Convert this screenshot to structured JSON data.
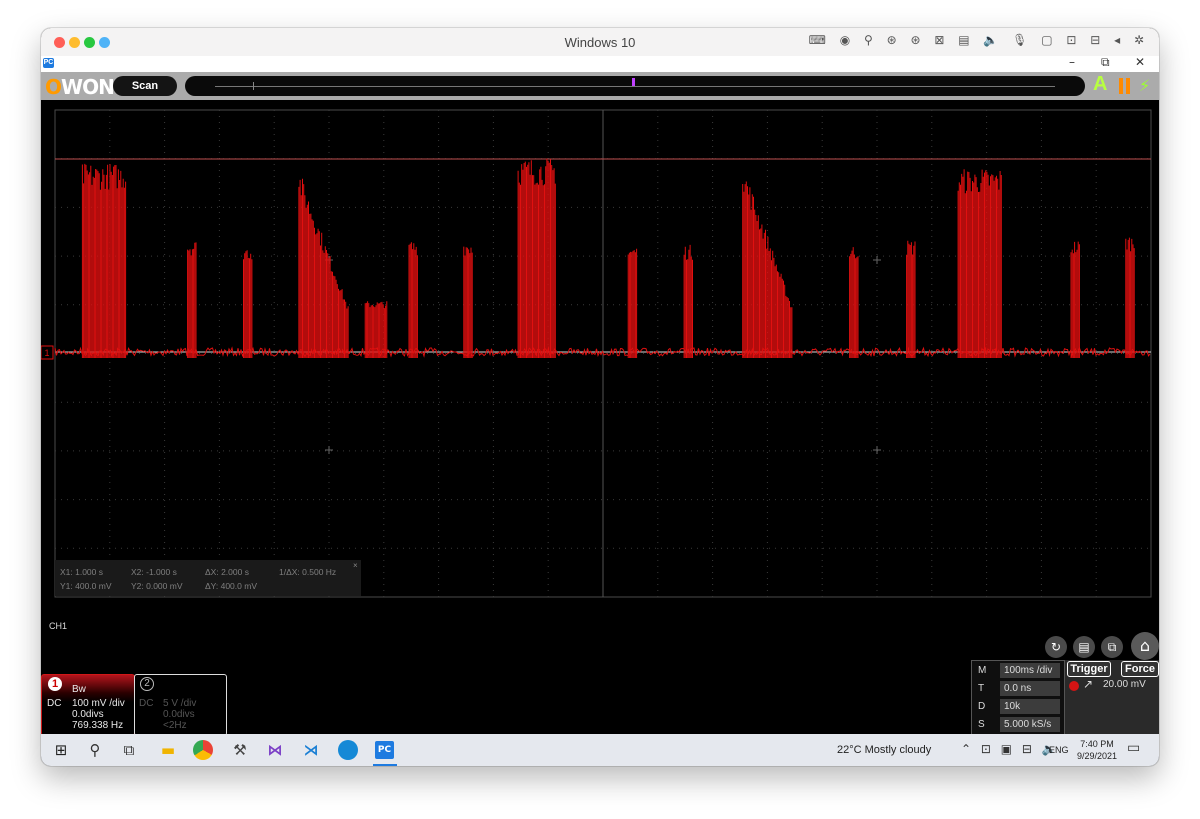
{
  "mac_window": {
    "title": "Windows 10",
    "traffic_lights": [
      "#ff5f57",
      "#febc2e",
      "#28c840",
      "#4fb3f7"
    ],
    "menu_icons": "⌨ ◉ ⚲ ⊛ ⊛ ⊠ ▤ 🔈 🎙 ▢ ⊡ ⊟ ◂ ✲"
  },
  "app_window": {
    "icon_label": "PC",
    "minimize": "–",
    "restore": "⧉",
    "close": "✕"
  },
  "toolbar": {
    "logo_o": "O",
    "logo_rest": "WON",
    "scan_label": "Scan",
    "run_label": "A"
  },
  "cursor_readout": {
    "x1": "X1: 1.000 s",
    "x2": "X2: -1.000 s",
    "dx": "ΔX: 2.000 s",
    "inv_dx": "1/ΔX: 0.500 Hz",
    "y1": "Y1: 400.0 mV",
    "y2": "Y2: 0.000 mV",
    "dy": "ΔY: 400.0 mV",
    "close": "×"
  },
  "channel_label": "CH1",
  "ch1": {
    "number": "1",
    "bw": "Bw",
    "coupling": "DC",
    "scale": "100 mV /div",
    "offset": "0.0divs",
    "freq": "769.338 Hz",
    "color": "#e01010"
  },
  "ch2": {
    "number": "2",
    "coupling": "DC",
    "scale": "5 V /div",
    "offset": "0.0divs",
    "freq": "<2Hz"
  },
  "timebase": [
    {
      "key": "M",
      "value": "100ms /div"
    },
    {
      "key": "T",
      "value": "0.0 ns"
    },
    {
      "key": "D",
      "value": "10k"
    },
    {
      "key": "S",
      "value": "5.000 kS/s"
    }
  ],
  "trigger": {
    "trigger_label": "Trigger",
    "force_label": "Force",
    "level": "20.00 mV"
  },
  "taskbar": {
    "weather": "22°C  Mostly cloudy",
    "tray": "⌃ ⊡ ▣ ⊟ 🔈",
    "lang": "ENG",
    "time": "7:40 PM",
    "date": "9/29/2021",
    "notif": "▭"
  },
  "icons": {
    "start": "windows-start-icon",
    "search": "search-icon",
    "taskview": "task-view-icon"
  },
  "chart_data": {
    "type": "line",
    "title": "",
    "xlabel": "",
    "ylabel": "",
    "series": [
      {
        "values_description_only_in_script": true
      }
    ],
    "grid": true,
    "bursts": [
      {
        "center": 0.045,
        "width": 0.04,
        "peak": 3.7
      },
      {
        "center": 0.125,
        "width": 0.008,
        "peak": 2.2
      },
      {
        "center": 0.176,
        "width": 0.008,
        "peak": 2.1
      },
      {
        "center": 0.245,
        "width": 0.045,
        "peak": 3.6,
        "decay": true
      },
      {
        "center": 0.293,
        "width": 0.02,
        "peak": 1.0
      },
      {
        "center": 0.327,
        "width": 0.008,
        "peak": 2.2
      },
      {
        "center": 0.377,
        "width": 0.008,
        "peak": 2.2
      },
      {
        "center": 0.44,
        "width": 0.035,
        "peak": 3.8
      },
      {
        "center": 0.527,
        "width": 0.008,
        "peak": 2.1
      },
      {
        "center": 0.578,
        "width": 0.008,
        "peak": 2.1
      },
      {
        "center": 0.65,
        "width": 0.045,
        "peak": 3.7,
        "decay": true
      },
      {
        "center": 0.729,
        "width": 0.008,
        "peak": 2.1
      },
      {
        "center": 0.781,
        "width": 0.008,
        "peak": 2.2
      },
      {
        "center": 0.844,
        "width": 0.04,
        "peak": 3.6
      },
      {
        "center": 0.931,
        "width": 0.008,
        "peak": 2.2
      },
      {
        "center": 0.981,
        "width": 0.008,
        "peak": 2.3
      }
    ]
  }
}
